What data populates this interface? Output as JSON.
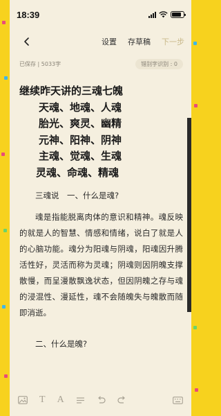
{
  "status": {
    "time": "18:39"
  },
  "toolbar": {
    "back_icon": "chevron-left-icon",
    "settings_label": "设置",
    "drafts_label": "存草稿",
    "next_label": "下一步"
  },
  "meta": {
    "saved_info": "已保存 | 5033字",
    "error_recognition": "错别字识别 : 0"
  },
  "article": {
    "title_lines": [
      "继续昨天讲的三魂七魄",
      "天魂、地魂、人魂",
      "胎光、爽灵、幽精",
      "元神、阳神、阴神",
      "主魂、觉魂、生魂",
      "灵魂、命魂、精魂"
    ],
    "heading1": "三魂说　一、什么是魂?",
    "paragraph1": "魂是指能脱离肉体的意识和精神。魂反映的就是人的智慧、情感和情绪，说白了就是人的心脑功能。魂分为阳魂与阴魂，阳魂因升腾活性好，灵活而称为灵魂；阴魂则因阴魄支撑散慢，而呈漫散飘逸状态，但因阴魄之存与魂的浸混性、漫延性，魂不会随魄失与魄散而随即消逝。",
    "heading2": "二、什么是魄?"
  },
  "bottom_toolbar": {
    "icons": [
      "image-icon",
      "text-style-icon",
      "font-size-icon",
      "list-icon",
      "undo-icon",
      "redo-icon",
      "keyboard-icon"
    ]
  }
}
